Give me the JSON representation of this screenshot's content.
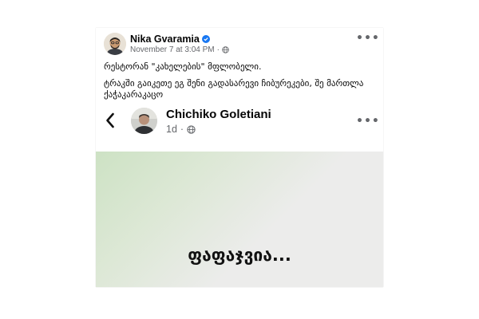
{
  "post": {
    "author": "Nika Gvaramia",
    "timestamp": "November 7 at 3:04 PM",
    "meta_separator": "·",
    "audience_icon": "globe-icon",
    "verified_icon": "verified-badge-icon",
    "more_icon": "more-options-icon",
    "text_lines": [
      "რესტორან \"კახელების\" მფლობელი.",
      "ტრაკში გაიკეთე ეგ შენი გადასარევი ჩიბურეკები, შე მართლა ქაჭაკარაკაცო"
    ]
  },
  "shared_post": {
    "back_icon": "chevron-left-icon",
    "author": "Chichiko Goletiani",
    "age": "1d",
    "meta_separator": "·",
    "audience_icon": "globe-icon",
    "more_icon": "more-options-icon",
    "image_text": "ფაფაჯვია..."
  },
  "colors": {
    "verified_blue": "#1877f2",
    "secondary_text": "#65676b",
    "image_green": "#cde2c4",
    "image_gray": "#ececeb"
  }
}
